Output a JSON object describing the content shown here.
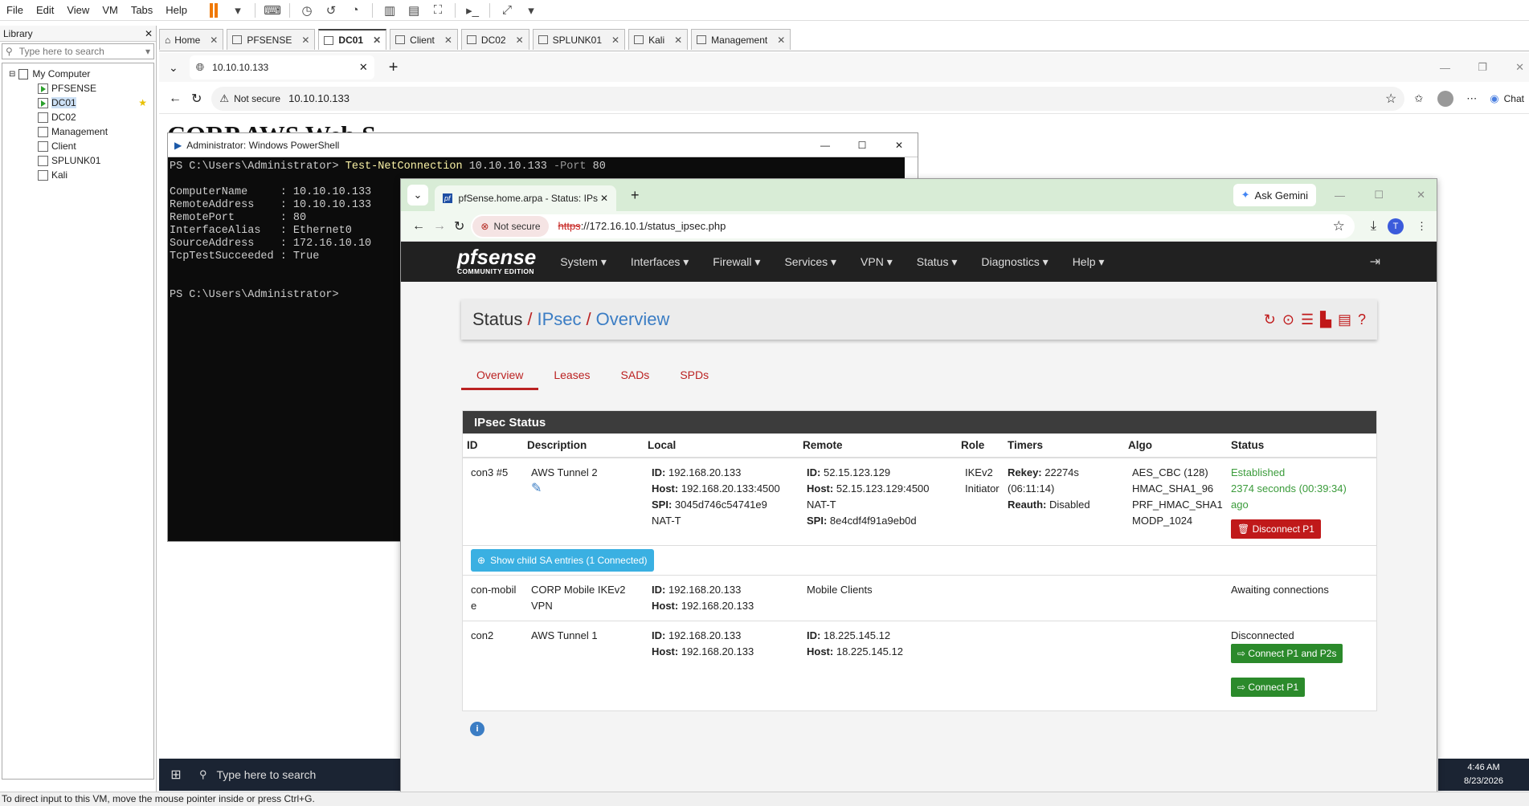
{
  "vmware": {
    "menu": [
      "File",
      "Edit",
      "View",
      "VM",
      "Tabs",
      "Help"
    ],
    "library_title": "Library",
    "library_search_placeholder": "Type here to search",
    "tree_root": "My Computer",
    "tree_items": [
      "PFSENSE",
      "DC01",
      "DC02",
      "Management",
      "Client",
      "SPLUNK01",
      "Kali"
    ],
    "tabs": [
      "Home",
      "PFSENSE",
      "DC01",
      "Client",
      "DC02",
      "SPLUNK01",
      "Kali",
      "Management"
    ],
    "status_text": "To direct input to this VM, move the mouse pointer inside or press Ctrl+G."
  },
  "edge": {
    "tab_title": "10.10.10.133",
    "not_secure": "Not secure",
    "url": "10.10.10.133",
    "chat": "Chat",
    "page_heading": "CORP AWS Web S"
  },
  "powershell": {
    "title": "Administrator: Windows PowerShell",
    "prompt": "PS C:\\Users\\Administrator>",
    "cmd": "Test-NetConnection",
    "args": "10.10.10.133",
    "param": "-Port",
    "param_val": "80",
    "output": "ComputerName     : 10.10.10.133\nRemoteAddress    : 10.10.10.133\nRemotePort       : 80\nInterfaceAlias   : Ethernet0\nSourceAddress    : 172.16.10.10\nTcpTestSucceeded : True",
    "prompt2": "PS C:\\Users\\Administrator>"
  },
  "taskbar": {
    "search_placeholder": "Type here to search",
    "time": "4:46 AM",
    "date": "8/23/2026"
  },
  "chrome": {
    "tab_title": "pfSense.home.arpa - Status: IPs",
    "ask_gemini": "Ask Gemini",
    "not_secure": "Not secure",
    "url_scheme": "https",
    "url_rest": "://172.16.10.1/status_ipsec.php",
    "avatar": "T"
  },
  "pfsense": {
    "logo": "pfsense",
    "logo_sub": "COMMUNITY EDITION",
    "nav": [
      "System",
      "Interfaces",
      "Firewall",
      "Services",
      "VPN",
      "Status",
      "Diagnostics",
      "Help"
    ],
    "crumb": [
      "Status",
      "IPsec",
      "Overview"
    ],
    "tabs": [
      "Overview",
      "Leases",
      "SADs",
      "SPDs"
    ],
    "panel_title": "IPsec Status",
    "columns": [
      "ID",
      "Description",
      "Local",
      "Remote",
      "Role",
      "Timers",
      "Algo",
      "Status"
    ],
    "rows": [
      {
        "id": "con3 #5",
        "desc": "AWS Tunnel 2",
        "local": {
          "id": "192.168.20.133",
          "host": "192.168.20.133:4500",
          "spi": "3045d746c54741e9",
          "natt": "NAT-T"
        },
        "remote": {
          "id": "52.15.123.129",
          "host": "52.15.123.129:4500",
          "natt": "NAT-T",
          "spi": "8e4cdf4f91a9eb0d"
        },
        "role": [
          "IKEv2",
          "Initiator"
        ],
        "timers": {
          "rekey": "22274s",
          "rekey2": "(06:11:14)",
          "reauth": "Disabled"
        },
        "algo": [
          "AES_CBC (128)",
          "HMAC_SHA1_96",
          "PRF_HMAC_SHA1",
          "MODP_1024"
        ],
        "status": "Established",
        "status2": "2374 seconds (00:39:34)",
        "status3": "ago",
        "button": "Disconnect P1"
      },
      {
        "id": "con-mobile",
        "desc": "CORP Mobile IKEv2 VPN",
        "local": {
          "id": "192.168.20.133",
          "host": "192.168.20.133"
        },
        "remote_text": "Mobile Clients",
        "status": "Awaiting connections"
      },
      {
        "id": "con2",
        "desc": "AWS Tunnel 1",
        "local": {
          "id": "192.168.20.133",
          "host": "192.168.20.133"
        },
        "remote": {
          "id": "18.225.145.12",
          "host": "18.225.145.12"
        },
        "status": "Disconnected",
        "btn1": "Connect P1 and P2s",
        "btn2": "Connect P1"
      }
    ],
    "child_sa_button": "Show child SA entries (1 Connected)",
    "labels": {
      "id": "ID:",
      "host": "Host:",
      "spi": "SPI:",
      "rekey": "Rekey:",
      "reauth": "Reauth:"
    }
  }
}
